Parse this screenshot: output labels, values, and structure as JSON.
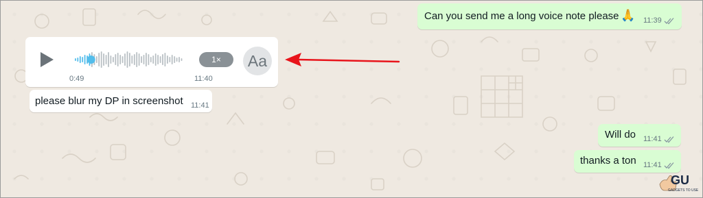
{
  "chat": {
    "messages": [
      {
        "direction": "outgoing",
        "text": "Can you send me a long voice note please",
        "emoji": "🙏",
        "time": "11:39",
        "status": "read"
      },
      {
        "direction": "incoming",
        "type": "voice",
        "duration": "0:49",
        "time": "11:40",
        "speed_label": "1×",
        "transcribe_label": "Aa",
        "progress": 0.15
      },
      {
        "direction": "incoming",
        "text": "please blur my DP in screenshot",
        "time": "11:41"
      },
      {
        "direction": "outgoing",
        "text": "Will do",
        "time": "11:41",
        "status": "read"
      },
      {
        "direction": "outgoing",
        "text": "thanks a ton",
        "time": "11:41",
        "status": "read"
      }
    ]
  },
  "colors": {
    "outgoing_bubble": "#d9fdd3",
    "incoming_bubble": "#ffffff",
    "wallpaper": "#efe9e1",
    "waveform_played": "#53bdeb",
    "waveform_unplayed": "#b9c0c4",
    "read_ticks": "#8696a0",
    "annotation_arrow": "#e8141b"
  },
  "icons": {
    "play": "play-icon",
    "ticks": "double-check-icon",
    "annotation": "red-arrow",
    "watermark": "gadgets-to-use-logo"
  }
}
